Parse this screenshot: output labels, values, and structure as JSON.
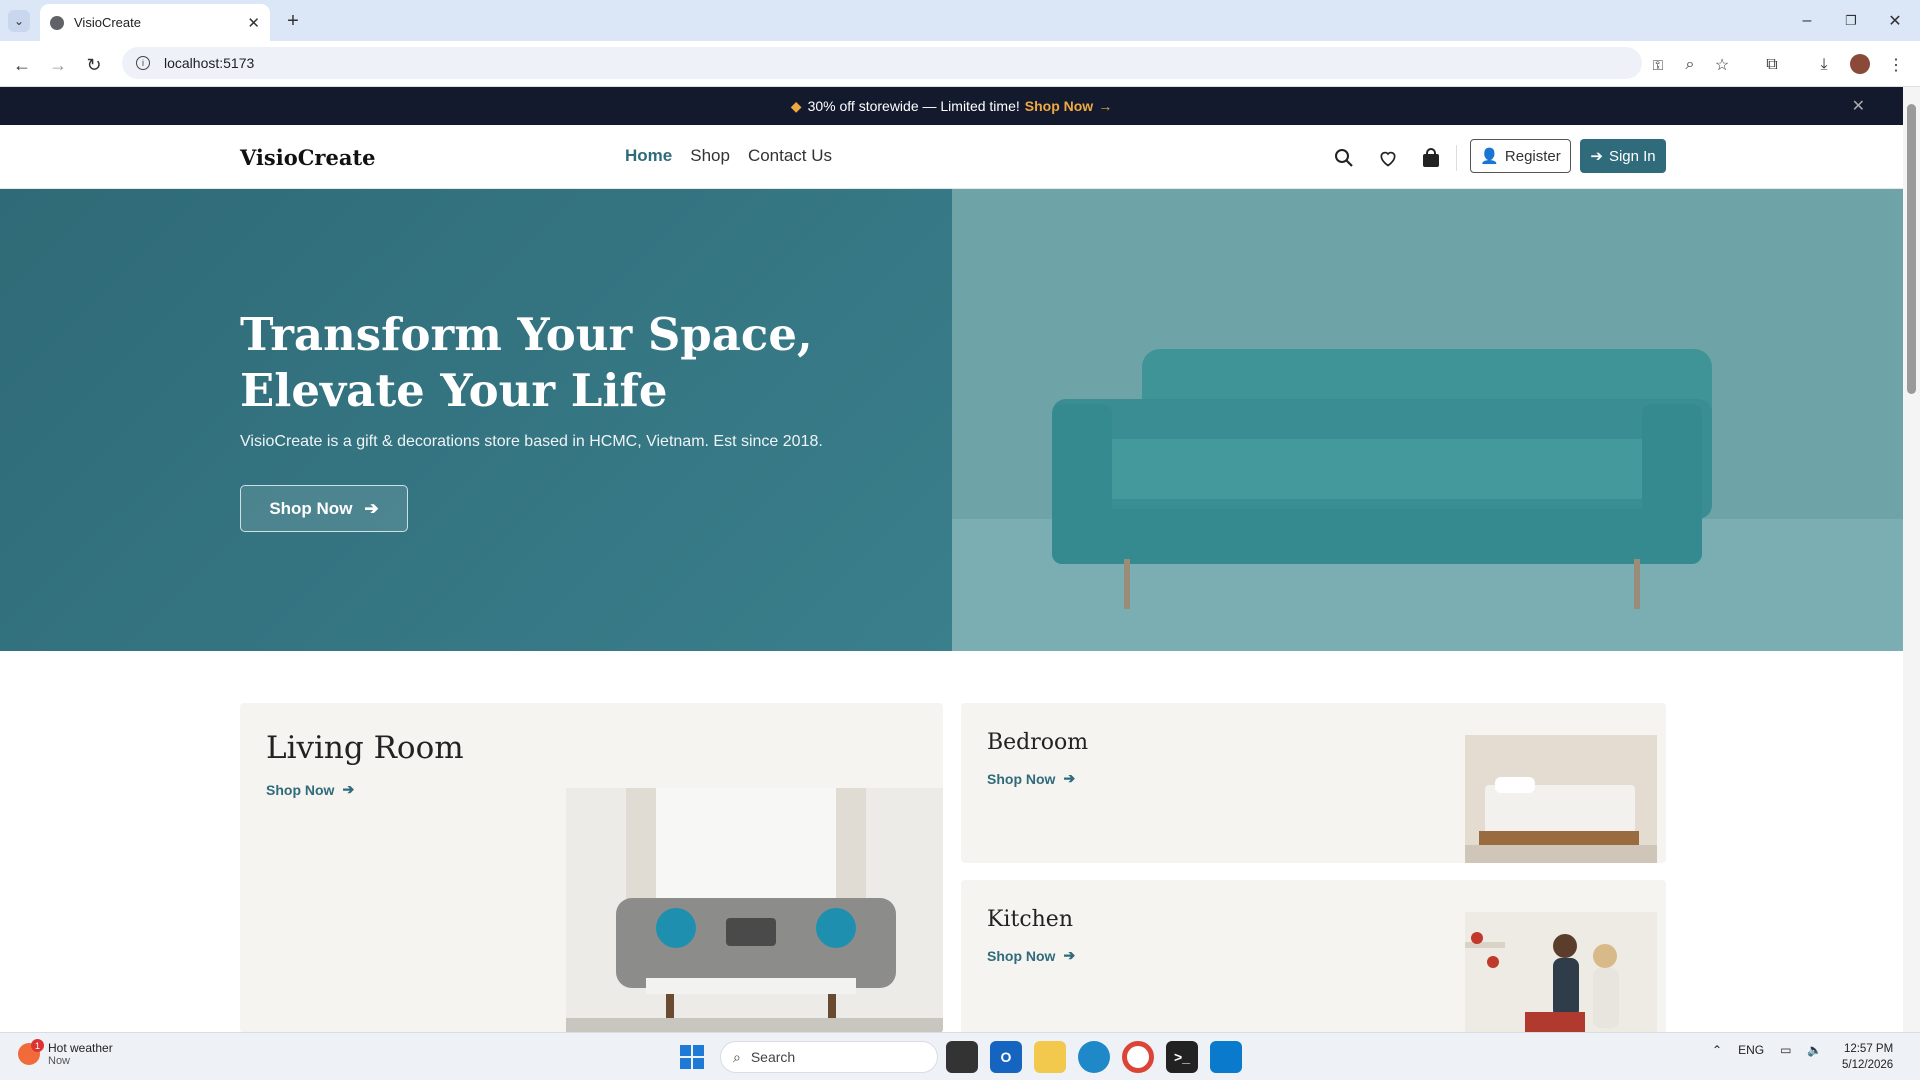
{
  "browser": {
    "tab_title": "VisioCreate",
    "url": "localhost:5173"
  },
  "promo": {
    "tag_icon": "tag-icon",
    "text": "30% off storewide — Limited time!",
    "link": "Shop Now",
    "arrow": "→",
    "close": "✕"
  },
  "nav": {
    "logo": "VisioCreate",
    "links": [
      "Home",
      "Shop",
      "Contact Us"
    ],
    "active": "Home",
    "register": "Register",
    "signin": "Sign In"
  },
  "hero": {
    "title_line1": "Transform Your Space,",
    "title_line2": "Elevate Your Life",
    "subtitle": "VisioCreate is a gift & decorations store based in HCMC, Vietnam. Est since 2018.",
    "button": "Shop Now"
  },
  "categories": [
    {
      "name": "Living Room",
      "link": "Shop Now"
    },
    {
      "name": "Bedroom",
      "link": "Shop Now"
    },
    {
      "name": "Kitchen",
      "link": "Shop Now"
    }
  ],
  "taskbar": {
    "weather_title": "Hot weather",
    "weather_sub": "Now",
    "weather_badge": "1",
    "search_placeholder": "Search",
    "lang": "ENG",
    "time": "12:57 PM",
    "date": "5/12/2026"
  },
  "colors": {
    "brand": "#2f6b7a",
    "promo_bg": "#141a2e",
    "promo_highlight": "#f0a840"
  }
}
